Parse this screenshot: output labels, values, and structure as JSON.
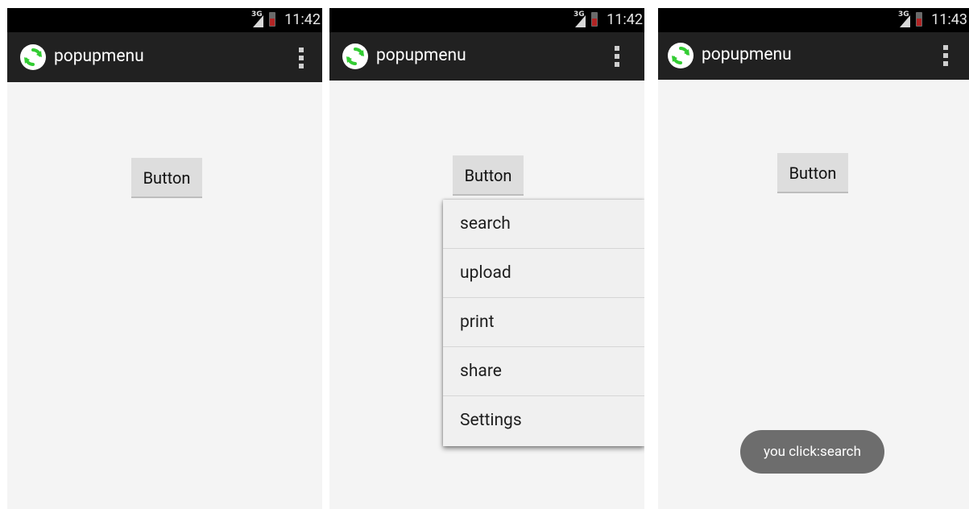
{
  "app": {
    "title": "popupmenu"
  },
  "screens": [
    {
      "time": "11:42",
      "network": "3G",
      "button_label": "Button"
    },
    {
      "time": "11:42",
      "network": "3G",
      "button_label": "Button"
    },
    {
      "time": "11:43",
      "network": "3G",
      "button_label": "Button"
    }
  ],
  "popup_menu": {
    "items": [
      "search",
      "upload",
      "print",
      "share",
      "Settings"
    ]
  },
  "toast": {
    "text": "you click:search"
  },
  "icons": {
    "app": "refresh-icon",
    "overflow": "overflow-menu-icon",
    "signal": "signal-icon",
    "battery": "battery-icon"
  },
  "colors": {
    "status_bar": "#000000",
    "action_bar": "#212121",
    "screen_bg": "#f4f4f4",
    "app_icon_green": "#33cc33",
    "battery_low": "#b22424",
    "toast_bg": "#6d6d6d"
  }
}
